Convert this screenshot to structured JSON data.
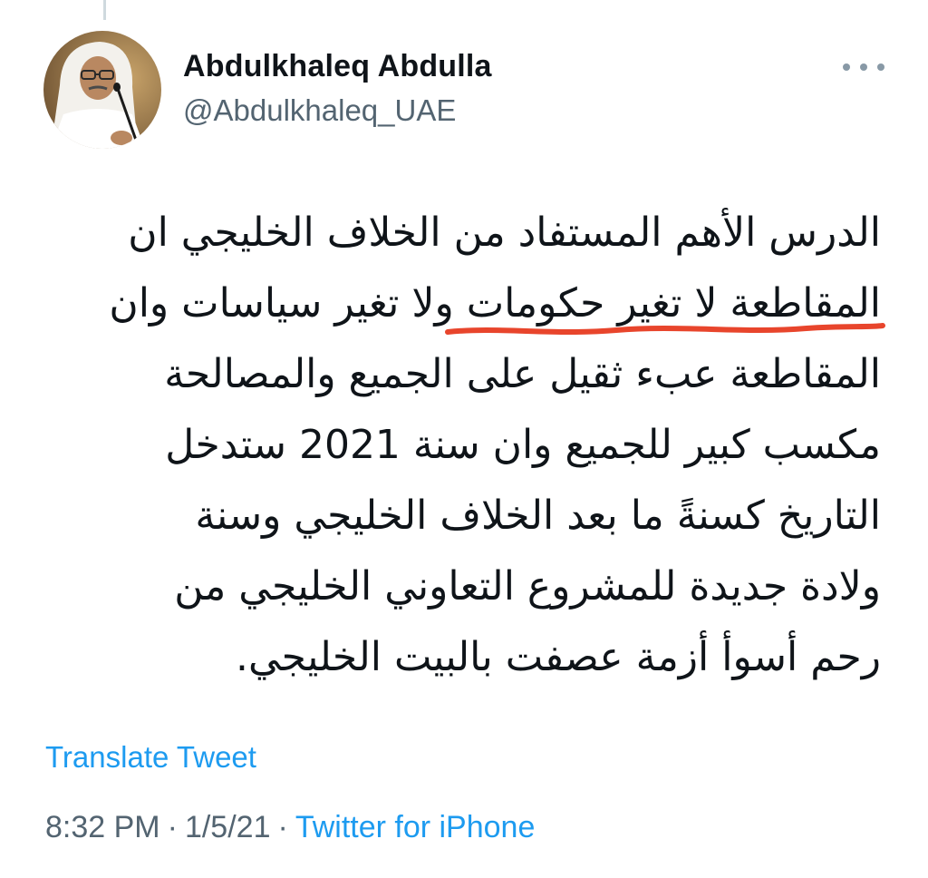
{
  "author": {
    "display_name": "Abdulkhaleq Abdulla",
    "handle": "@Abdulkhaleq_UAE",
    "avatar_icon": "user-avatar-photo"
  },
  "more_icon": "more-dots-icon",
  "tweet": {
    "lines": [
      "الدرس الأهم المستفاد من الخلاف الخليجي ان",
      "المقاطعة لا تغير حكومات ولا تغير سياسات وان",
      "المقاطعة عبء ثقيل على الجميع والمصالحة",
      "مكسب كبير للجميع وان سنة 2021 ستدخل",
      "التاريخ كسنةً ما بعد الخلاف الخليجي وسنة",
      "ولادة جديدة للمشروع التعاوني الخليجي من",
      "رحم أسوأ أزمة عصفت بالبيت الخليجي."
    ],
    "highlight_color": "#e8452c"
  },
  "translate_label": "Translate Tweet",
  "meta": {
    "time": "8:32 PM",
    "separator": "·",
    "date": "1/5/21",
    "source": "Twitter for iPhone"
  },
  "colors": {
    "link": "#1d9bf0",
    "secondary_text": "#536471",
    "primary_text": "#0f1419"
  }
}
